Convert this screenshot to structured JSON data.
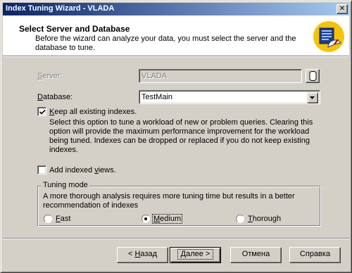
{
  "window": {
    "title": "Index Tuning Wizard - VLADA",
    "close_label": "✕"
  },
  "header": {
    "title": "Select Server and Database",
    "description": "Before the wizard can analyze your data, you must select the server and the database to tune."
  },
  "form": {
    "server": {
      "label_prefix": "",
      "label_mnemonic": "S",
      "label_rest": "erver:",
      "value": "VLADA",
      "enabled": false
    },
    "database": {
      "label_mnemonic": "D",
      "label_rest": "atabase:",
      "value": "TestMain"
    },
    "keep_indexes": {
      "label_mnemonic": "K",
      "label_rest": "eep all existing indexes.",
      "checked": true,
      "description": "Select this option to tune a workload of new or problem queries. Clearing this option will provide the maximum performance improvement for the workload being tuned. Indexes can be dropped or replaced if you do not keep existing indexes."
    },
    "add_indexed_views": {
      "label_prefix": "Add indexed ",
      "label_mnemonic": "v",
      "label_rest": "iews.",
      "checked": false
    }
  },
  "tuning_mode": {
    "legend": "Tuning mode",
    "description": "A more thorough analysis requires more tuning time but results in a better recommendation of indexes",
    "options": [
      {
        "mnemonic": "F",
        "rest": "ast",
        "selected": false
      },
      {
        "mnemonic": "M",
        "rest": "edium",
        "selected": true
      },
      {
        "mnemonic": "T",
        "rest": "horough",
        "selected": false
      }
    ]
  },
  "buttons": {
    "back": {
      "prefix": "< ",
      "mnemonic": "Н",
      "rest": "азад"
    },
    "next": {
      "mnemonic": "Д",
      "rest": "алее >"
    },
    "cancel": "Отмена",
    "help": "Справка"
  }
}
